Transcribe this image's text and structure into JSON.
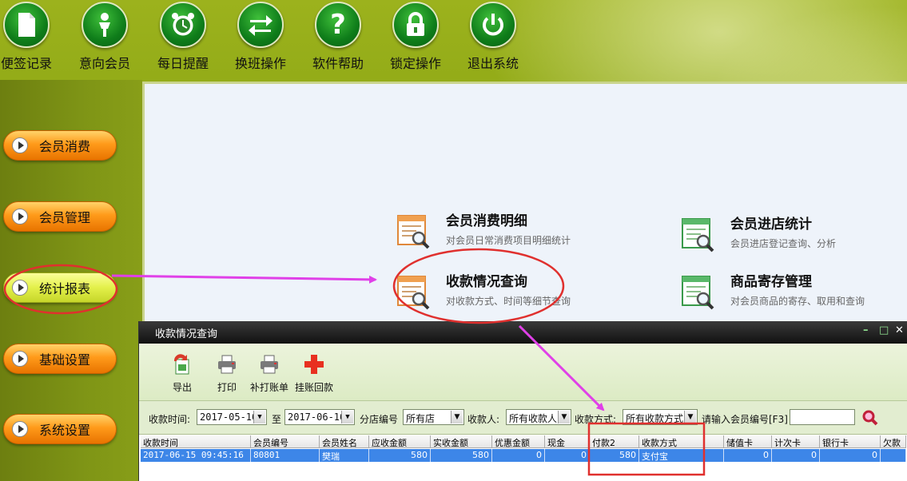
{
  "top_bar": {
    "buttons": [
      {
        "label": "便签记录",
        "icon": "note-icon"
      },
      {
        "label": "意向会员",
        "icon": "person-icon"
      },
      {
        "label": "每日提醒",
        "icon": "alarm-clock-icon"
      },
      {
        "label": "换班操作",
        "icon": "swap-arrows-icon"
      },
      {
        "label": "软件帮助",
        "icon": "question-icon"
      },
      {
        "label": "锁定操作",
        "icon": "lock-icon"
      },
      {
        "label": "退出系统",
        "icon": "power-icon"
      }
    ]
  },
  "sidebar": {
    "items": [
      {
        "label": "会员消费"
      },
      {
        "label": "会员管理"
      },
      {
        "label": "统计报表",
        "active": true
      },
      {
        "label": "基础设置"
      },
      {
        "label": "系统设置"
      }
    ]
  },
  "reports": [
    {
      "title": "会员消费明细",
      "desc": "对会员日常消费项目明细统计"
    },
    {
      "title": "会员进店统计",
      "desc": "会员进店登记查询、分析"
    },
    {
      "title": "收款情况查询",
      "desc": "对收款方式、时间等细节查询"
    },
    {
      "title": "商品寄存管理",
      "desc": "对会员商品的寄存、取用和查询"
    }
  ],
  "window": {
    "title": "收款情况查询",
    "controls": {
      "minimize": "–",
      "maximize": "□",
      "close": "✕"
    },
    "toolbar": [
      {
        "label": "导出",
        "icon": "export-icon"
      },
      {
        "label": "打印",
        "icon": "printer-icon"
      },
      {
        "label": "补打账单",
        "icon": "reprint-icon"
      },
      {
        "label": "挂账回款",
        "icon": "plus-icon"
      }
    ],
    "filter": {
      "time_label": "收款时间:",
      "date_from": "2017-05-16",
      "to_label": "至",
      "date_to": "2017-06-16",
      "branch_label": "分店编号",
      "branch_value": "所有店",
      "payee_label": "收款人:",
      "payee_value": "所有收款人",
      "method_label": "收款方式:",
      "method_value": "所有收款方式",
      "member_label": "请输入会员编号[F3]",
      "member_value": ""
    },
    "table": {
      "columns": [
        "收款时间",
        "会员编号",
        "会员姓名",
        "应收金额",
        "实收金额",
        "优惠金额",
        "现金",
        "付款2",
        "收款方式",
        "储值卡",
        "计次卡",
        "银行卡",
        "欠款"
      ],
      "rows": [
        [
          "2017-06-15 09:45:16",
          "80801",
          "樊瑞",
          "580",
          "580",
          "0",
          "0",
          "580",
          "支付宝",
          "0",
          "0",
          "0",
          ""
        ]
      ]
    }
  },
  "colors": {
    "background": "#8da714",
    "accent_orange": "#ff9a1a",
    "active_yellow": "#e3f04a",
    "annotation": "#e0302e",
    "arrow": "#e040e8",
    "selection": "#3d86e8"
  }
}
